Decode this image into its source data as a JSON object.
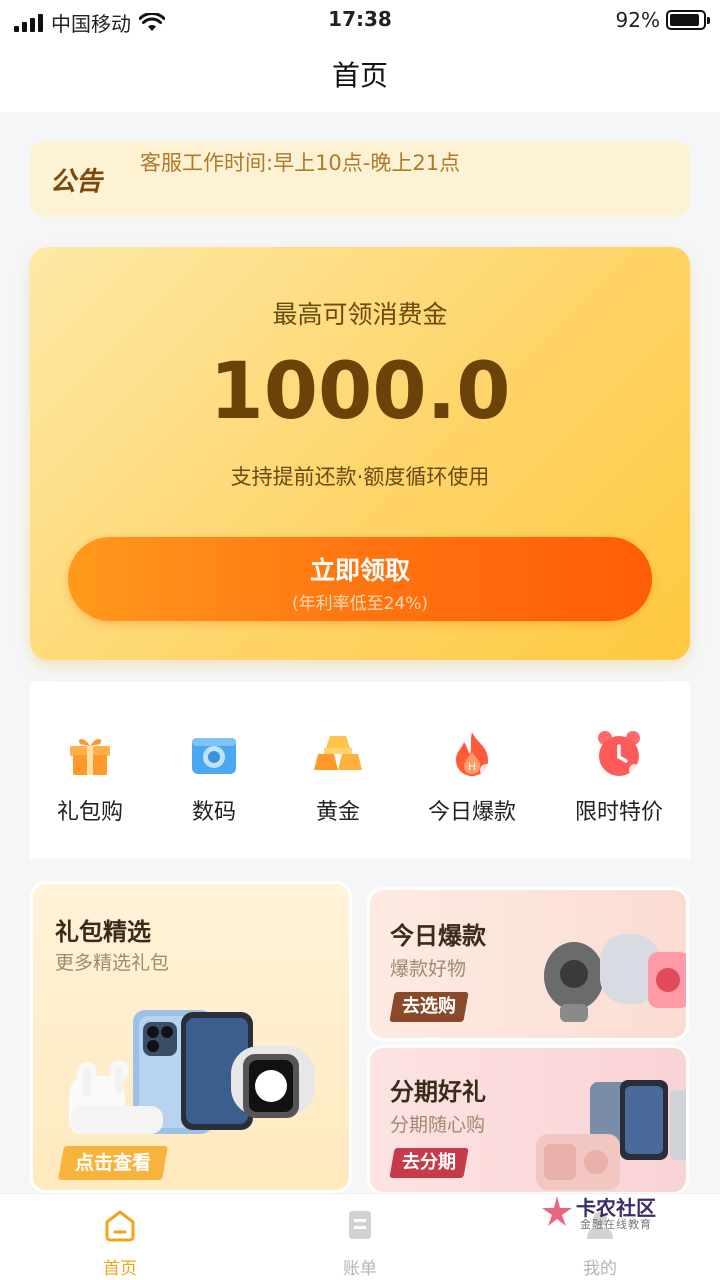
{
  "status_bar": {
    "carrier": "中国移动",
    "time": "17:38",
    "battery_text": "92%",
    "battery_level": 0.92
  },
  "nav": {
    "title": "首页"
  },
  "notice": {
    "tag": "公告",
    "text": "客服工作时间:早上10点-晚上21点"
  },
  "hero": {
    "label": "最高可领消费金",
    "amount": "1000.0",
    "desc": "支持提前还款·额度循环使用",
    "button_label": "立即领取",
    "button_sub": "(年利率低至24%)"
  },
  "categories": [
    {
      "label": "礼包购",
      "icon": "gift-icon"
    },
    {
      "label": "数码",
      "icon": "camera-icon"
    },
    {
      "label": "黄金",
      "icon": "gold-bar-icon"
    },
    {
      "label": "今日爆款",
      "icon": "fire-icon"
    },
    {
      "label": "限时特价",
      "icon": "alarm-clock-icon"
    }
  ],
  "promos": {
    "gift": {
      "title": "礼包精选",
      "subtitle": "更多精选礼包",
      "button": "点击查看"
    },
    "hot": {
      "title": "今日爆款",
      "subtitle": "爆款好物",
      "button": "去选购"
    },
    "installment": {
      "title": "分期好礼",
      "subtitle": "分期随心购",
      "button": "去分期"
    }
  },
  "tabbar": [
    {
      "label": "首页",
      "icon": "home-icon",
      "active": true
    },
    {
      "label": "账单",
      "icon": "bill-icon",
      "active": false
    },
    {
      "label": "我的",
      "icon": "profile-icon",
      "active": false
    }
  ],
  "watermark": {
    "title": "卡农社区",
    "subtitle": "金融在线教育"
  },
  "colors": {
    "accent": "#ff7210",
    "active_tab": "#f2a51a",
    "inactive_tab": "#c9c9c9",
    "brown_text": "#6b4308"
  }
}
